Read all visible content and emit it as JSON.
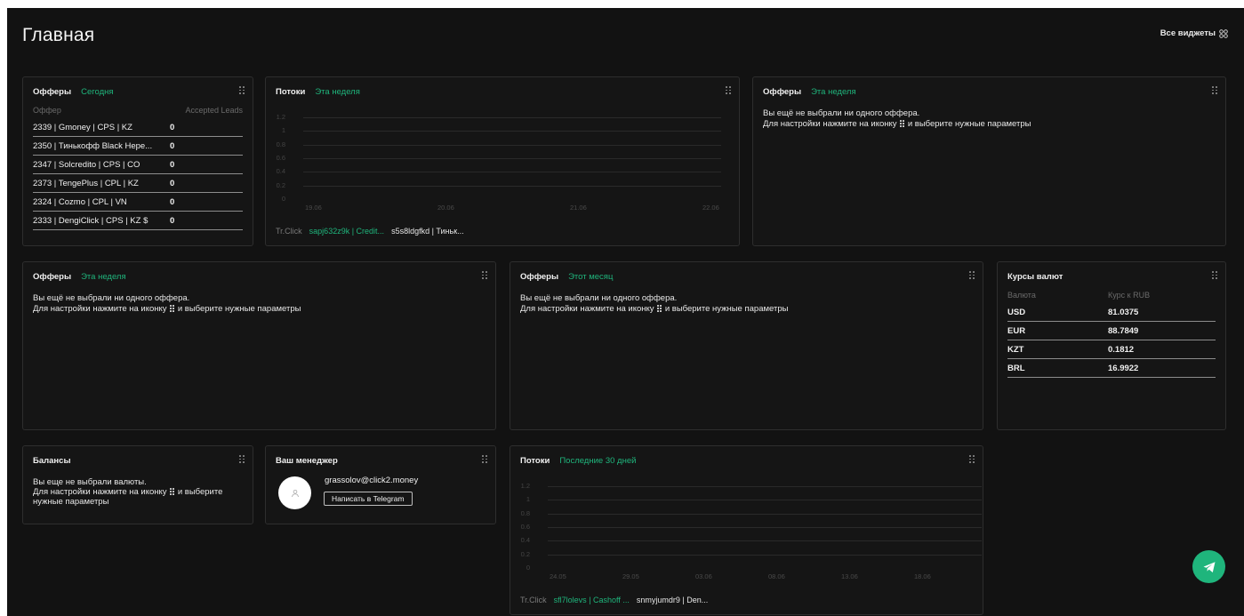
{
  "header": {
    "title": "Главная",
    "all_widgets_label": "Все виджеты"
  },
  "offers_today": {
    "title": "Офферы",
    "period": "Сегодня",
    "columns": [
      "Оффер",
      "Accepted Leads"
    ],
    "rows": [
      {
        "offer": "2339 | Gmoney | CPS | KZ",
        "leads": "0"
      },
      {
        "offer": "2350 | Тинькофф Black Нере...",
        "leads": "0"
      },
      {
        "offer": "2347 | Solcredito | CPS | CO",
        "leads": "0"
      },
      {
        "offer": "2373 | TengePlus | CPL | KZ",
        "leads": "0"
      },
      {
        "offer": "2324 | Cozmo | CPL | VN",
        "leads": "0"
      },
      {
        "offer": "2333 | DengiClick | CPS | KZ $",
        "leads": "0"
      }
    ]
  },
  "flows_week": {
    "title": "Потоки",
    "period": "Эта неделя",
    "legend": [
      "Tr.Click",
      "sapj632z9k | Credit...",
      "s5s8ldgfkd | Тиньк..."
    ],
    "chart_data": {
      "type": "line",
      "x": [
        "19.06",
        "20.06",
        "21.06",
        "22.06"
      ],
      "y_ticks": [
        "1.2",
        "1",
        "0.8",
        "0.6",
        "0.4",
        "0.2",
        "0"
      ],
      "ylim": [
        0,
        1.2
      ],
      "series": [],
      "grid": true
    }
  },
  "offers_week_1": {
    "title": "Офферы",
    "period": "Эта неделя",
    "message_line1": "Вы ещё не выбрали ни одного оффера.",
    "message_line2_a": "Для настройки нажмите на иконку",
    "message_line2_b": "и выберите нужные параметры"
  },
  "offers_week_2": {
    "title": "Офферы",
    "period": "Эта неделя",
    "message_line1": "Вы ещё не выбрали ни одного оффера.",
    "message_line2_a": "Для настройки нажмите на иконку",
    "message_line2_b": "и выберите нужные параметры"
  },
  "offers_month": {
    "title": "Офферы",
    "period": "Этот месяц",
    "message_line1": "Вы ещё не выбрали ни одного оффера.",
    "message_line2_a": "Для настройки нажмите на иконку",
    "message_line2_b": "и выберите нужные параметры"
  },
  "currency": {
    "title": "Курсы валют",
    "columns": [
      "Валюта",
      "Курс к RUB"
    ],
    "rows": [
      {
        "code": "USD",
        "rate": "81.0375"
      },
      {
        "code": "EUR",
        "rate": "88.7849"
      },
      {
        "code": "KZT",
        "rate": "0.1812"
      },
      {
        "code": "BRL",
        "rate": "16.9922"
      }
    ]
  },
  "balances": {
    "title": "Балансы",
    "message_line1": "Вы еще не выбрали валюты.",
    "message_line2_a": "Для настройки нажмите на иконку",
    "message_line2_b": "и выберите",
    "message_line3": "нужные параметры"
  },
  "manager": {
    "title": "Ваш менеджер",
    "email": "grassolov@click2.money",
    "button_label": "Написать в Telegram"
  },
  "flows_30d": {
    "title": "Потоки",
    "period": "Последние 30 дней",
    "legend": [
      "Tr.Click",
      "sfl7lolevs | Cashoff ...",
      "snmyjumdr9 | Den..."
    ],
    "chart_data": {
      "type": "line",
      "x": [
        "24.05",
        "29.05",
        "03.06",
        "08.06",
        "13.06",
        "18.06"
      ],
      "y_ticks": [
        "1.2",
        "1",
        "0.8",
        "0.6",
        "0.4",
        "0.2",
        "0"
      ],
      "ylim": [
        0,
        1.2
      ],
      "series": [],
      "grid": true
    }
  },
  "colors": {
    "background": "#121212",
    "card": "#151515",
    "accent": "#1fb57c"
  },
  "icons": [
    "widgets-grid-icon",
    "drag-handle-icon",
    "user-avatar-icon",
    "telegram-send-icon"
  ]
}
